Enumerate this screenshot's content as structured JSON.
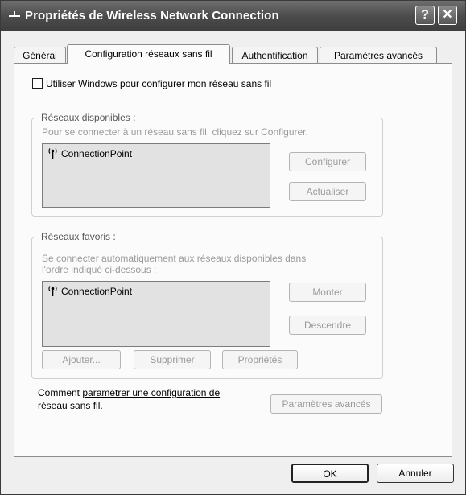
{
  "window": {
    "title": "Propriétés de Wireless Network Connection",
    "help_button": "?",
    "close_button": "✕"
  },
  "tabs": [
    {
      "label": "Général"
    },
    {
      "label": "Configuration réseaux sans fil"
    },
    {
      "label": "Authentification"
    },
    {
      "label": "Paramètres avancés"
    }
  ],
  "use_windows_checkbox": {
    "label": "Utiliser Windows pour configurer mon réseau sans fil",
    "checked": false
  },
  "available_networks": {
    "legend": "Réseaux disponibles :",
    "hint": "Pour se connecter à un réseau sans fil, cliquez sur Configurer.",
    "items": [
      "ConnectionPoint"
    ],
    "configure_button": "Configurer",
    "refresh_button": "Actualiser"
  },
  "preferred_networks": {
    "legend": "Réseaux favoris :",
    "hint_line1": "Se connecter automatiquement aux réseaux disponibles dans",
    "hint_line2": "l'ordre indiqué ci-dessous :",
    "items": [
      "ConnectionPoint"
    ],
    "up_button": "Monter",
    "down_button": "Descendre",
    "add_button": "Ajouter...",
    "remove_button": "Supprimer",
    "properties_button": "Propriétés"
  },
  "help": {
    "prefix": "Comment ",
    "link_line1": "paramétrer une configuration de",
    "link_line2": "réseau sans fil."
  },
  "advanced_button": "Paramètres avancés",
  "ok_button": "OK",
  "cancel_button": "Annuler",
  "colors": {
    "titlebar": "#4c4c4c",
    "dialog": "#efefef",
    "panel": "#fbfbfb",
    "listbox": "#e2e2e2",
    "disabled_text": "#9a9a9a"
  }
}
